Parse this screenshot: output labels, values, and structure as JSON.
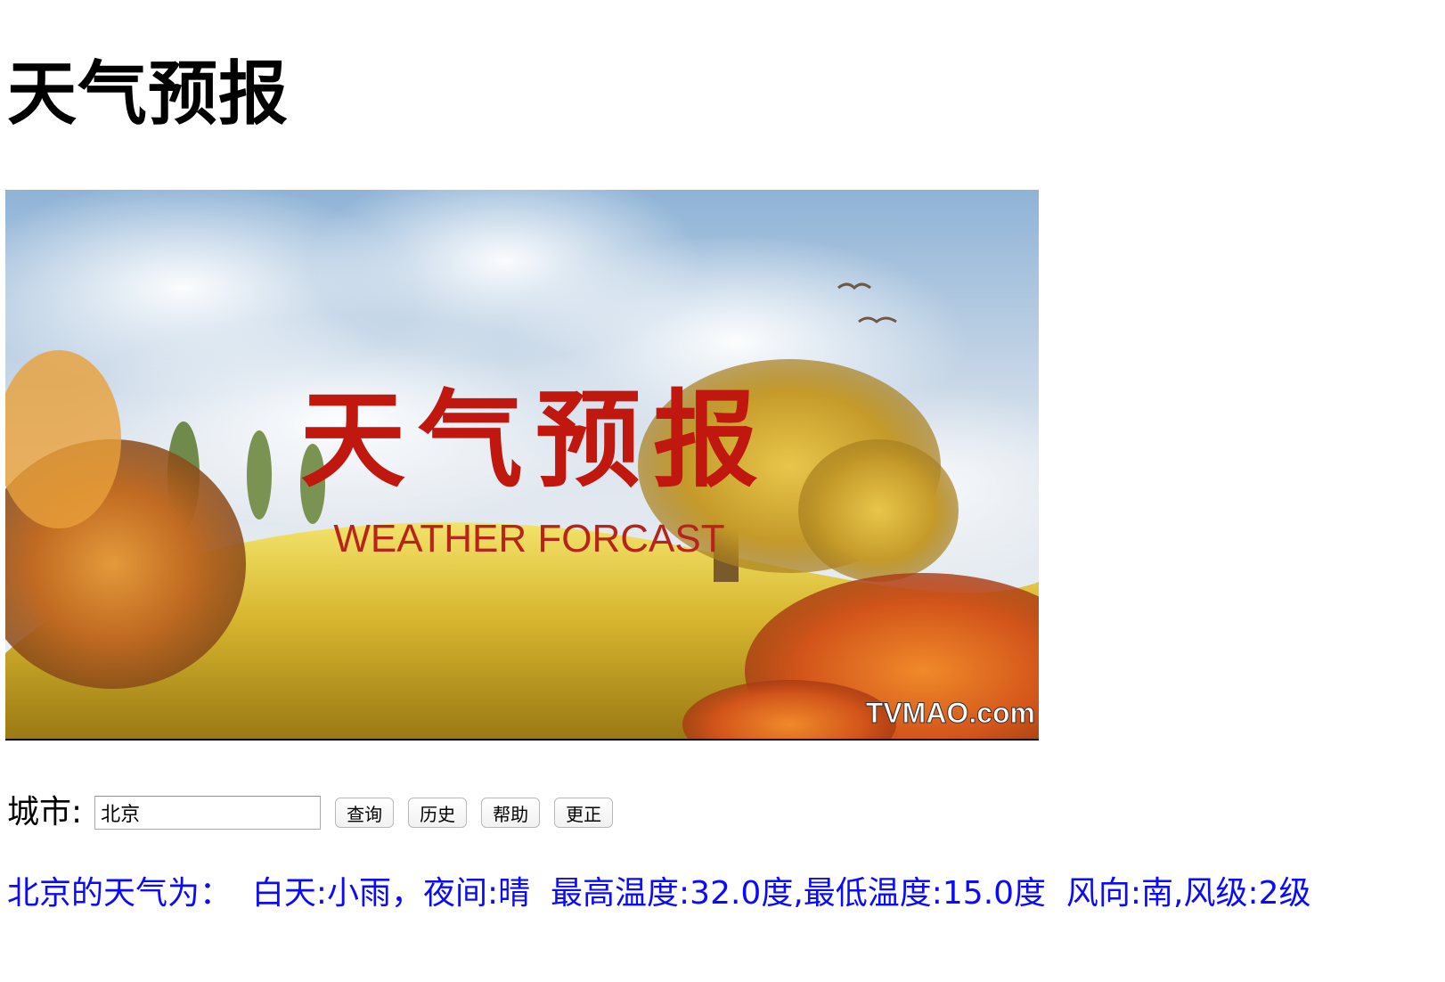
{
  "page": {
    "title": "天气预报"
  },
  "banner": {
    "title_cn": "天气预报",
    "title_en": "WEATHER FORCAST",
    "watermark": "TVMAO.com"
  },
  "query": {
    "city_label": "城市:",
    "city_value": "北京",
    "buttons": {
      "search": "查询",
      "history": "历史",
      "help": "帮助",
      "correct": "更正"
    }
  },
  "result": {
    "text": "北京的天气为：  白天:小雨，夜间:晴  最高温度:32.0度,最低温度:15.0度  风向:南,风级:2级"
  },
  "colors": {
    "result_text": "#0a0aff",
    "banner_title": "#c0180f"
  }
}
